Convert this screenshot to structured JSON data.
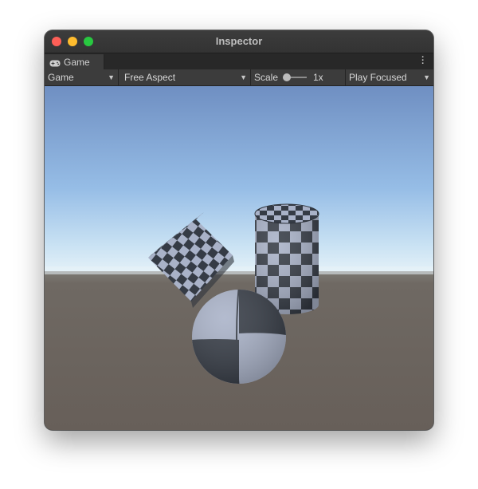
{
  "window": {
    "title": "Inspector"
  },
  "tabs": [
    {
      "label": "Game",
      "icon": "gamepad-icon"
    }
  ],
  "toolbar": {
    "display_dropdown": "Game",
    "aspect_dropdown": "Free Aspect",
    "scale_label": "Scale",
    "scale_value": "1x",
    "play_mode_dropdown": "Play Focused"
  },
  "scene": {
    "objects": [
      "checkered-cube",
      "checkered-cylinder",
      "checkered-sphere"
    ],
    "colors": {
      "sky_top": "#6f8fc2",
      "horizon": "#e3f0f7",
      "ground": "#68605a",
      "checker_dark": "#353b45",
      "checker_light": "#a9b2c8"
    }
  }
}
